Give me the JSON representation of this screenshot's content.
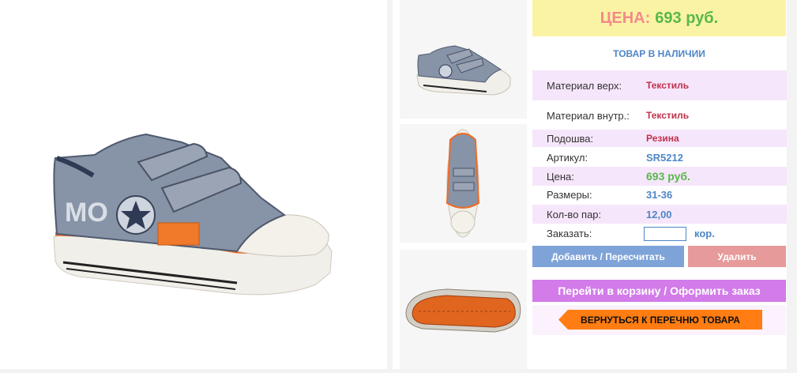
{
  "product": {
    "price_label": "ЦЕНА:",
    "price_value": "693 руб.",
    "stock_status": "ТОВАР В НАЛИЧИИ"
  },
  "specs": [
    {
      "label": "Материал верх:",
      "value": "Текстиль"
    },
    {
      "label": "Материал внутр.:",
      "value": "Текстиль"
    },
    {
      "label": "Подошва:",
      "value": "Резина"
    },
    {
      "label": "Артикул:",
      "value": "SR5212"
    },
    {
      "label": "Цена:",
      "value": "693 руб."
    },
    {
      "label": "Размеры:",
      "value": "31-36"
    },
    {
      "label": "Кол-во пар:",
      "value": "12,00"
    }
  ],
  "order": {
    "label": "Заказать:",
    "quantity_value": "",
    "unit": "кор."
  },
  "buttons": {
    "add": "Добавить / Пересчитать",
    "delete": "Удалить",
    "cart": "Перейти в корзину / Оформить заказ",
    "back": "ВЕРНУТЬСЯ К ПЕРЕЧНЮ ТОВАРА"
  },
  "colors": {
    "accent_blue": "#4e86c6",
    "price_green": "#57b84a",
    "cart_purple": "#d27be9",
    "back_orange": "#ff7d12"
  }
}
